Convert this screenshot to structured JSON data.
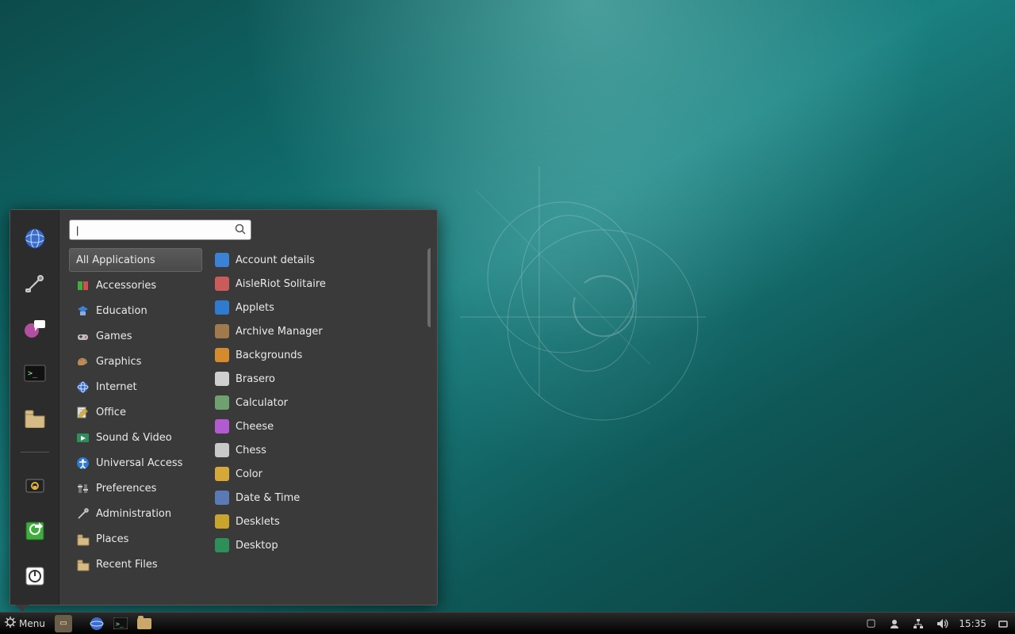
{
  "panel": {
    "menu_label": "Menu",
    "clock": "15:35"
  },
  "menu": {
    "search_placeholder": "",
    "categories": [
      {
        "label": "All Applications",
        "icon": "all",
        "selected": true
      },
      {
        "label": "Accessories",
        "icon": "accessories"
      },
      {
        "label": "Education",
        "icon": "education"
      },
      {
        "label": "Games",
        "icon": "games"
      },
      {
        "label": "Graphics",
        "icon": "graphics"
      },
      {
        "label": "Internet",
        "icon": "internet"
      },
      {
        "label": "Office",
        "icon": "office"
      },
      {
        "label": "Sound & Video",
        "icon": "sound-video"
      },
      {
        "label": "Universal Access",
        "icon": "universal-access"
      },
      {
        "label": "Preferences",
        "icon": "preferences"
      },
      {
        "label": "Administration",
        "icon": "administration"
      },
      {
        "label": "Places",
        "icon": "places"
      },
      {
        "label": "Recent Files",
        "icon": "recent-files"
      }
    ],
    "apps": [
      {
        "label": "Account details",
        "icon": "account",
        "color": "#3b82d6"
      },
      {
        "label": "AisleRiot Solitaire",
        "icon": "cards",
        "color": "#c95b5b"
      },
      {
        "label": "Applets",
        "icon": "applets",
        "color": "#2f7bd0"
      },
      {
        "label": "Archive Manager",
        "icon": "archive",
        "color": "#a07a4a"
      },
      {
        "label": "Backgrounds",
        "icon": "backgrounds",
        "color": "#d68a2e"
      },
      {
        "label": "Brasero",
        "icon": "brasero",
        "color": "#cfcfcf"
      },
      {
        "label": "Calculator",
        "icon": "calculator",
        "color": "#6fa06f"
      },
      {
        "label": "Cheese",
        "icon": "cheese",
        "color": "#b25ad0"
      },
      {
        "label": "Chess",
        "icon": "chess",
        "color": "#c9c9c9"
      },
      {
        "label": "Color",
        "icon": "color",
        "color": "#d6a83a"
      },
      {
        "label": "Date & Time",
        "icon": "date-time",
        "color": "#5a7ab5"
      },
      {
        "label": "Desklets",
        "icon": "desklets",
        "color": "#caa52e"
      },
      {
        "label": "Desktop",
        "icon": "desktop",
        "color": "#2f8f5a"
      }
    ],
    "favorites": [
      {
        "name": "web-browser",
        "icon": "globe"
      },
      {
        "name": "system-tools",
        "icon": "tools"
      },
      {
        "name": "messaging",
        "icon": "chat"
      },
      {
        "name": "terminal",
        "icon": "terminal"
      },
      {
        "name": "files",
        "icon": "folder"
      }
    ],
    "session": [
      {
        "name": "lock-screen",
        "icon": "lock"
      },
      {
        "name": "logout",
        "icon": "logout"
      },
      {
        "name": "shutdown",
        "icon": "power"
      }
    ]
  }
}
